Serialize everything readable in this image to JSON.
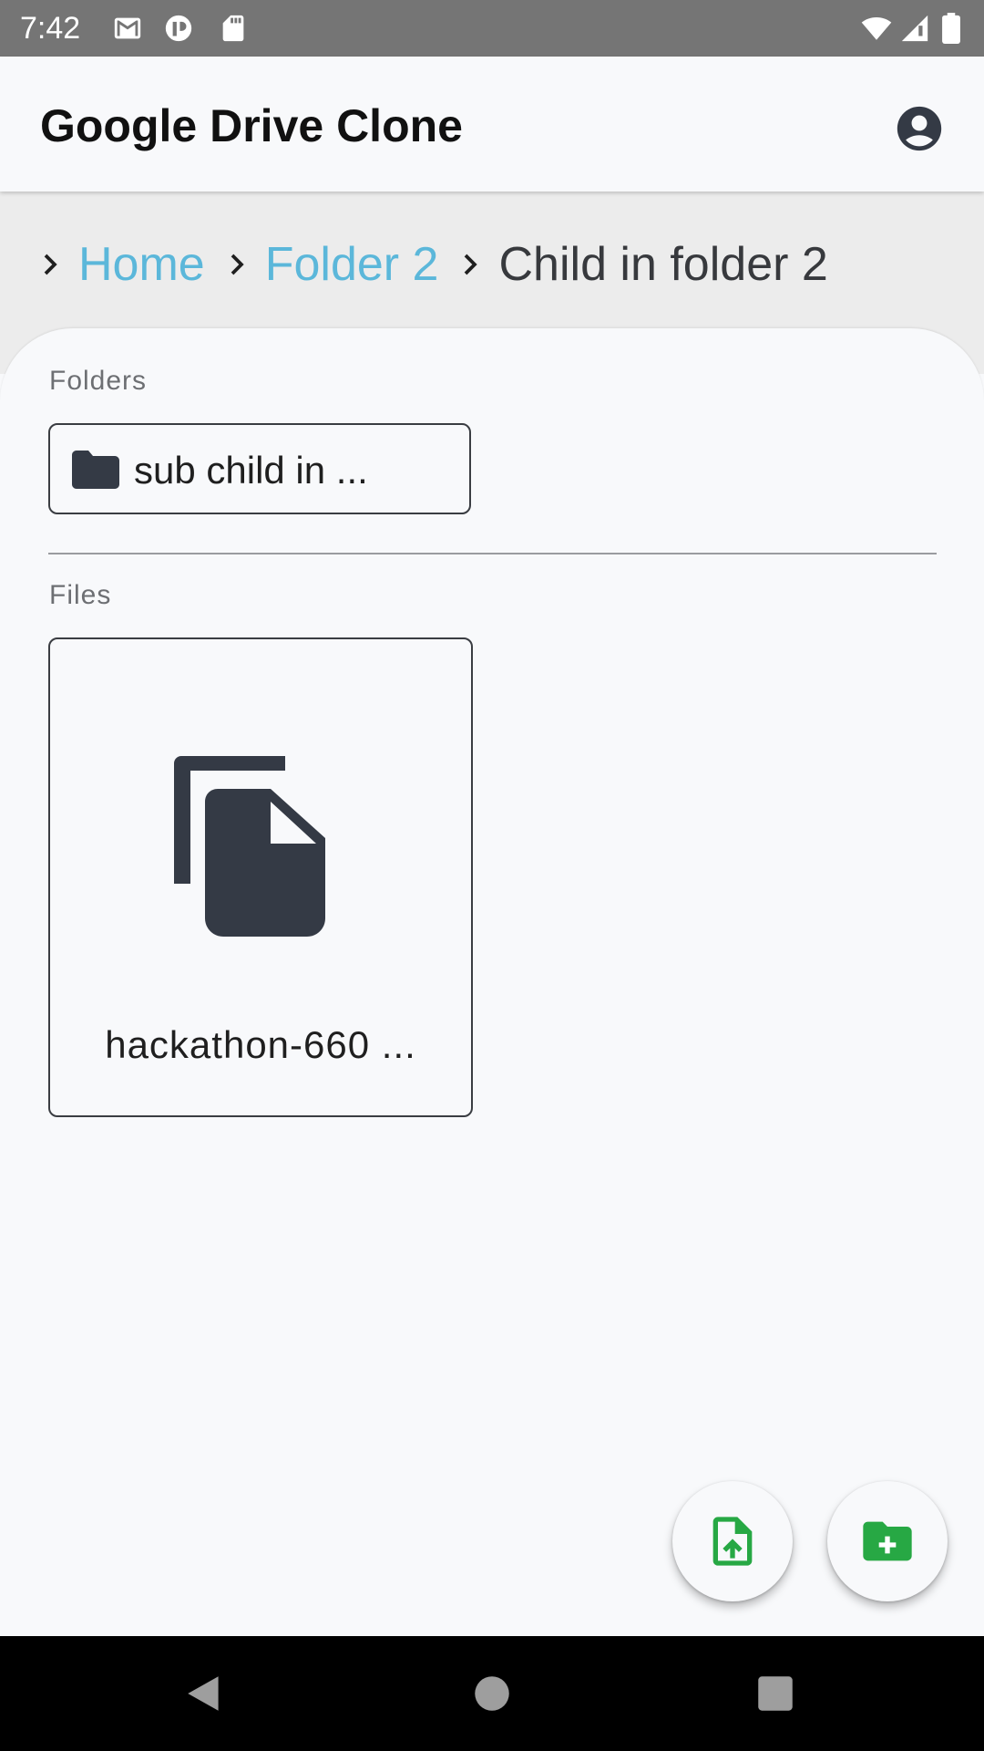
{
  "status_bar": {
    "time": "7:42",
    "icons": [
      "gmail-icon",
      "fontbook-icon",
      "sdcard-icon",
      "wifi-icon",
      "cell-signal-icon",
      "battery-icon"
    ]
  },
  "app_bar": {
    "title": "Google Drive Clone",
    "account_icon": "account-circle-icon"
  },
  "breadcrumb": {
    "separator_icon": "chevron-right-icon",
    "items": [
      {
        "label": "Home",
        "link": true
      },
      {
        "label": "Folder 2",
        "link": true
      },
      {
        "label": "Child in folder 2",
        "link": false
      }
    ]
  },
  "folders_section": {
    "label": "Folders",
    "items": [
      {
        "name": "sub child in  ...",
        "icon": "folder-icon"
      }
    ]
  },
  "files_section": {
    "label": "Files",
    "items": [
      {
        "name": "hackathon-660 ...",
        "icon": "file-copy-icon"
      }
    ]
  },
  "fabs": {
    "upload_icon": "upload-file-icon",
    "new_folder_icon": "create-new-folder-icon",
    "accent_color": "#27a844"
  },
  "colors": {
    "link": "#5bb7da",
    "icon_dark": "#343a45",
    "status_bar": "#757575",
    "breadcrumb_bg": "#ececec",
    "surface": "#f8f9fb"
  },
  "nav_bar": {
    "buttons": [
      "back-icon",
      "home-icon",
      "recents-icon"
    ]
  }
}
